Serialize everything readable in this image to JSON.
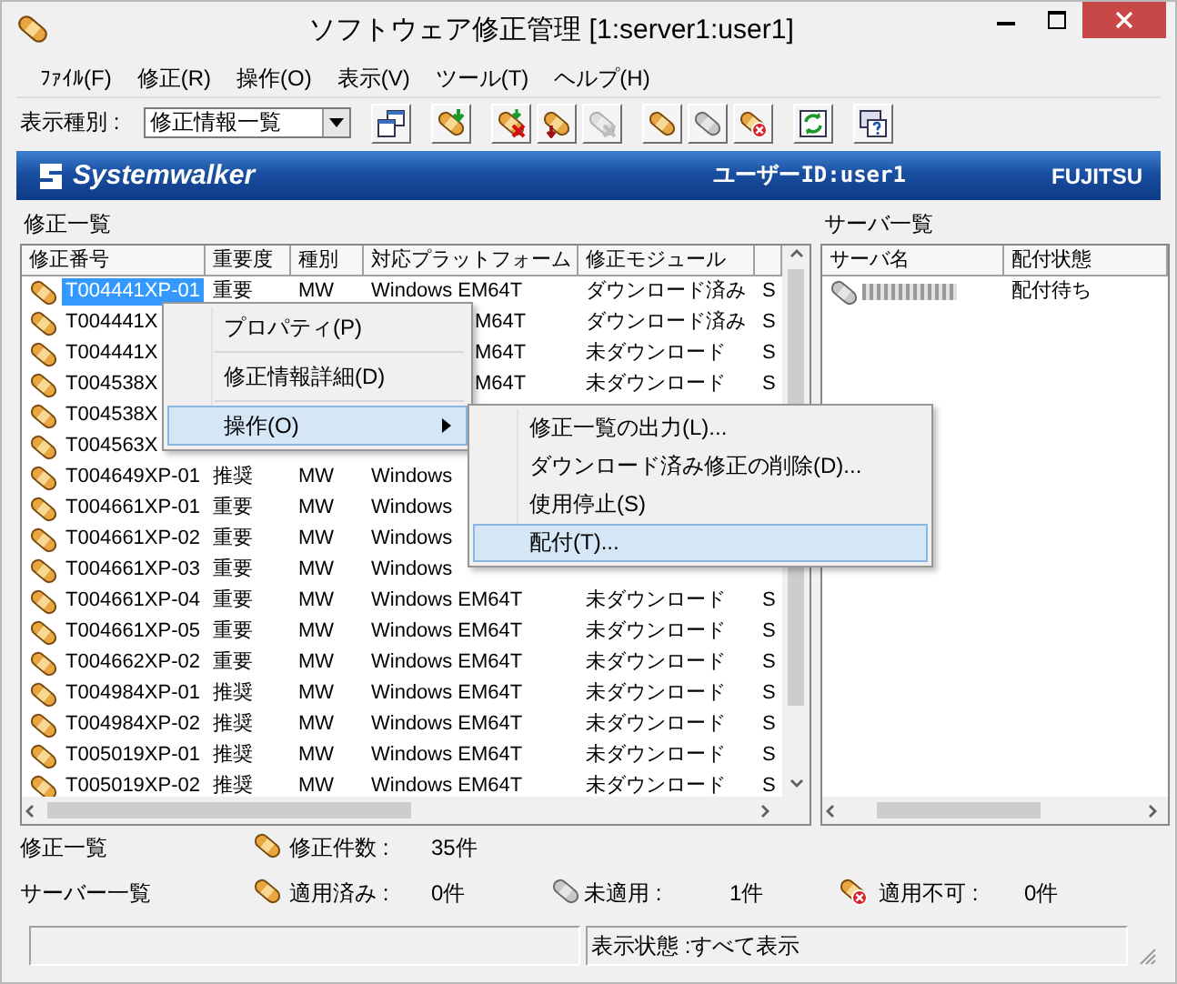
{
  "window": {
    "title": "ソフトウェア修正管理 [1:server1:user1]"
  },
  "menu_bar": [
    "ﾌｧｲﾙ(F)",
    "修正(R)",
    "操作(O)",
    "表示(V)",
    "ツール(T)",
    "ヘルプ(H)"
  ],
  "toolbar": {
    "label": "表示種別 :",
    "view_select": {
      "value": "修正情報一覧"
    },
    "button_groups": [
      [
        {
          "kind": "windows",
          "disabled": false
        }
      ],
      [
        {
          "kind": "patch-download",
          "disabled": false
        }
      ],
      [
        {
          "kind": "patch-delete",
          "disabled": false
        },
        {
          "kind": "patch-down",
          "disabled": false
        },
        {
          "kind": "patch-cross",
          "disabled": true
        }
      ],
      [
        {
          "kind": "patch",
          "disabled": false
        },
        {
          "kind": "patch-grey",
          "disabled": false
        },
        {
          "kind": "patch-error",
          "disabled": false
        }
      ],
      [
        {
          "kind": "refresh",
          "disabled": false
        }
      ],
      [
        {
          "kind": "help",
          "disabled": false
        }
      ]
    ]
  },
  "banner": {
    "logo": "Systemwalker",
    "user": "ユーザーID:user1",
    "vendor": "FUJITSU"
  },
  "patch_list": {
    "title": "修正一覧",
    "columns": [
      "修正番号",
      "重要度",
      "種別",
      "対応プラットフォーム",
      "修正モジュール"
    ],
    "rows": [
      {
        "selected": true,
        "cells": [
          "T004441XP-01",
          "重要",
          "MW",
          "Windows EM64T",
          "ダウンロード済み",
          "S"
        ]
      },
      {
        "selected": false,
        "cells": [
          "T004441X",
          null,
          null,
          "M64T",
          "ダウンロード済み",
          "S"
        ]
      },
      {
        "selected": false,
        "cells": [
          "T004441X",
          null,
          null,
          "M64T",
          "未ダウンロード",
          "S"
        ]
      },
      {
        "selected": false,
        "cells": [
          "T004538X",
          null,
          null,
          "M64T",
          "未ダウンロード",
          "S"
        ]
      },
      {
        "selected": false,
        "cells": [
          "T004538X",
          null,
          null,
          null,
          null,
          null
        ]
      },
      {
        "selected": false,
        "cells": [
          "T004563X",
          null,
          null,
          null,
          null,
          null
        ]
      },
      {
        "selected": false,
        "cells": [
          "T004649XP-01",
          "推奨",
          "MW",
          "Windows",
          null,
          null
        ]
      },
      {
        "selected": false,
        "cells": [
          "T004661XP-01",
          "重要",
          "MW",
          "Windows",
          null,
          null
        ]
      },
      {
        "selected": false,
        "cells": [
          "T004661XP-02",
          "重要",
          "MW",
          "Windows",
          null,
          null
        ]
      },
      {
        "selected": false,
        "cells": [
          "T004661XP-03",
          "重要",
          "MW",
          "Windows",
          null,
          null
        ]
      },
      {
        "selected": false,
        "cells": [
          "T004661XP-04",
          "重要",
          "MW",
          "Windows EM64T",
          "未ダウンロード",
          "S"
        ]
      },
      {
        "selected": false,
        "cells": [
          "T004661XP-05",
          "重要",
          "MW",
          "Windows EM64T",
          "未ダウンロード",
          "S"
        ]
      },
      {
        "selected": false,
        "cells": [
          "T004662XP-02",
          "重要",
          "MW",
          "Windows EM64T",
          "未ダウンロード",
          "S"
        ]
      },
      {
        "selected": false,
        "cells": [
          "T004984XP-01",
          "推奨",
          "MW",
          "Windows EM64T",
          "未ダウンロード",
          "S"
        ]
      },
      {
        "selected": false,
        "cells": [
          "T004984XP-02",
          "推奨",
          "MW",
          "Windows EM64T",
          "未ダウンロード",
          "S"
        ]
      },
      {
        "selected": false,
        "cells": [
          "T005019XP-01",
          "推奨",
          "MW",
          "Windows EM64T",
          "未ダウンロード",
          "S"
        ]
      },
      {
        "selected": false,
        "cells": [
          "T005019XP-02",
          "推奨",
          "MW",
          "Windows EM64T",
          "未ダウンロード",
          "S"
        ]
      }
    ]
  },
  "server_list": {
    "title": "サーバ一覧",
    "columns": [
      "サーバ名",
      "配付状態"
    ],
    "rows": [
      {
        "name_redacted": true,
        "status": "配付待ち"
      }
    ]
  },
  "context_menu": {
    "items": [
      {
        "kind": "item",
        "label": "プロパティ(P)",
        "selected": false,
        "has_submenu": false
      },
      {
        "kind": "separator"
      },
      {
        "kind": "item",
        "label": "修正情報詳細(D)",
        "selected": false,
        "has_submenu": false
      },
      {
        "kind": "separator"
      },
      {
        "kind": "item",
        "label": "操作(O)",
        "selected": true,
        "has_submenu": true
      }
    ],
    "submenu": {
      "items": [
        {
          "label": "修正一覧の出力(L)...",
          "selected": false
        },
        {
          "label": "ダウンロード済み修正の削除(D)...",
          "selected": false
        },
        {
          "label": "使用停止(S)",
          "selected": false
        },
        {
          "label": "配付(T)...",
          "selected": true
        }
      ]
    }
  },
  "summary": [
    {
      "label": "修正一覧",
      "counts": [
        {
          "kind": "patch",
          "label": "修正件数 :",
          "value": "35件"
        }
      ]
    },
    {
      "label": "サーバー一覧",
      "counts": [
        {
          "kind": "patch",
          "label": "適用済み :",
          "value": "0件"
        },
        {
          "kind": "patch-grey",
          "label": "未適用 :",
          "value": "1件"
        },
        {
          "kind": "patch-error",
          "label": "適用不可 :",
          "value": "0件"
        }
      ]
    }
  ],
  "status_bar": {
    "view_state": "表示状態 :すべて表示"
  }
}
